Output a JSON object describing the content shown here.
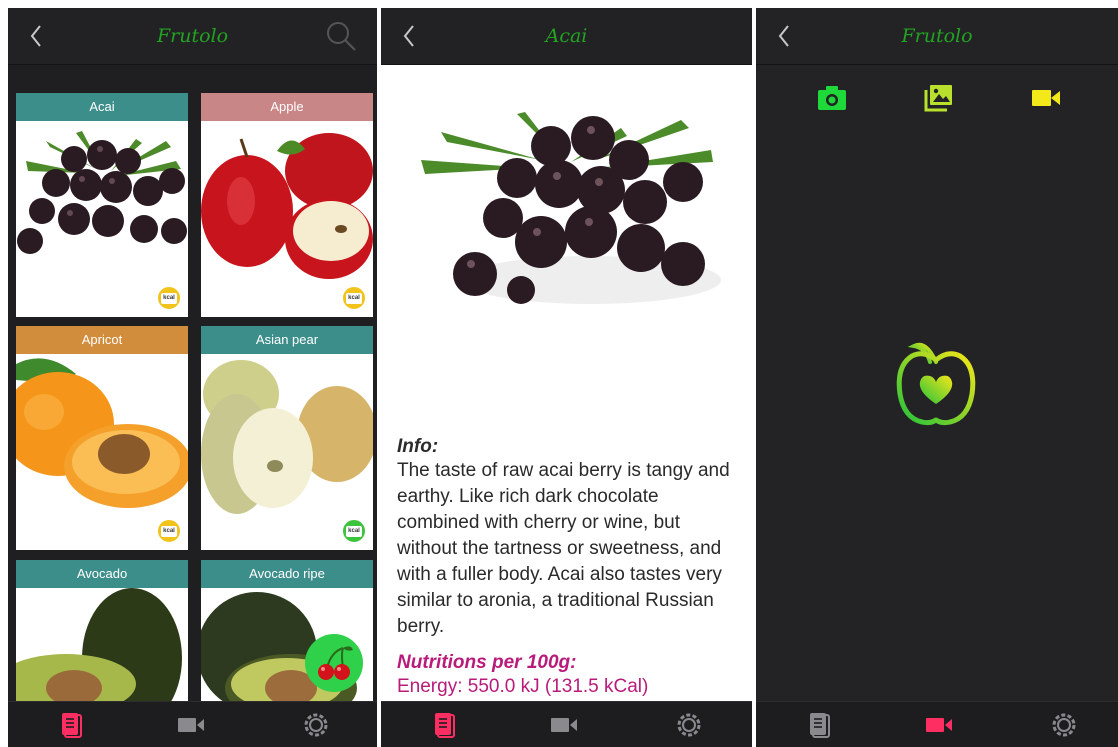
{
  "left": {
    "title": "Frutolo",
    "cards": [
      {
        "label": "Acai",
        "color": "#3c8e8b"
      },
      {
        "label": "Apple",
        "color": "#c98686"
      },
      {
        "label": "Apricot",
        "color": "#d18d3c"
      },
      {
        "label": "Asian pear",
        "color": "#3c8e8b"
      },
      {
        "label": "Avocado",
        "color": "#3c8e8b"
      },
      {
        "label": "Avocado ripe",
        "color": "#3c8e8b"
      }
    ],
    "kcal": "kcal"
  },
  "detail": {
    "title": "Acai",
    "info_heading": "Info:",
    "info_text": "The taste of raw acai berry is tangy and earthy. Like rich dark chocolate combined with cherry or wine, but without the tartness or sweetness, and with a fuller body. Acai also tastes very similar to aronia, a traditional Russian berry.",
    "nutrition_heading": "Nutritions per 100g:",
    "energy": "Energy: 550.0 kJ (131.5 kCal)"
  },
  "right": {
    "title": "Frutolo"
  },
  "colors": {
    "accent_pink": "#ff2e62",
    "brand_green": "#22a322",
    "inactive": "#8a8a8e"
  }
}
